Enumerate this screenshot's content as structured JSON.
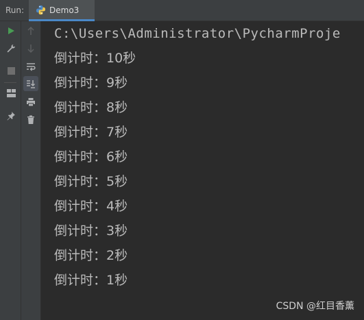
{
  "tabbar": {
    "run_label": "Run:",
    "tab_label": "Demo3",
    "tab_icon": "python-icon"
  },
  "toolbar": {
    "left_column": [
      "run-icon",
      "wrench-icon",
      "stop-icon",
      "layout-icon",
      "pin-icon"
    ],
    "right_column": [
      "arrow-up-icon",
      "arrow-down-icon",
      "soft-wrap-icon",
      "scroll-to-end-icon",
      "print-icon",
      "trash-icon"
    ]
  },
  "console": {
    "command_line": "C:\\Users\\Administrator\\PycharmProje",
    "output_lines": [
      "倒计时：10秒",
      "倒计时：9秒",
      "倒计时：8秒",
      "倒计时：7秒",
      "倒计时：6秒",
      "倒计时：5秒",
      "倒计时：4秒",
      "倒计时：3秒",
      "倒计时：2秒",
      "倒计时：1秒"
    ]
  },
  "watermark": "CSDN @红目香薰",
  "colors": {
    "background": "#2b2b2b",
    "toolbar": "#3c3f41",
    "text": "#bbbbbb",
    "accent": "#4a88c7",
    "run_green": "#499c54"
  }
}
